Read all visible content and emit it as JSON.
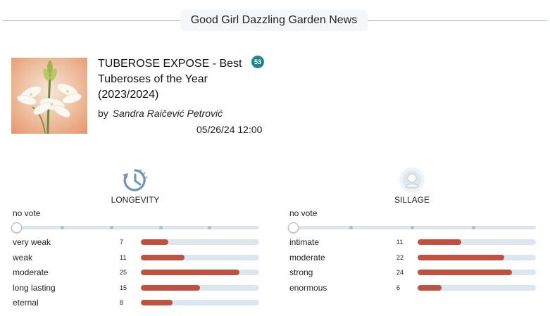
{
  "header": {
    "title": "Good Girl Dazzling Garden News"
  },
  "article": {
    "title": "TUBEROSE EXPOSE - Best Tuberoses of the Year (2023/2024)",
    "comment_count": "53",
    "byline_prefix": "by",
    "author": "Sandra Raičević Petrović",
    "date": "05/26/24 12:00",
    "thumb_icon": "tuberose-flower-image"
  },
  "longevity": {
    "label": "LONGEVITY",
    "icon": "clock-history-icon",
    "vote_label": "no vote",
    "max": 30,
    "rows": [
      {
        "label": "very weak",
        "count": 7
      },
      {
        "label": "weak",
        "count": 11
      },
      {
        "label": "moderate",
        "count": 25
      },
      {
        "label": "long lasting",
        "count": 15
      },
      {
        "label": "eternal",
        "count": 8
      }
    ]
  },
  "sillage": {
    "label": "SILLAGE",
    "icon": "person-aura-icon",
    "vote_label": "no vote",
    "max": 30,
    "rows": [
      {
        "label": "intimate",
        "count": 11
      },
      {
        "label": "moderate",
        "count": 22
      },
      {
        "label": "strong",
        "count": 24
      },
      {
        "label": "enormous",
        "count": 6
      }
    ]
  },
  "colors": {
    "bar_fill": "#c0503f",
    "bar_track": "#dbe6ef",
    "badge": "#1b8a8a"
  }
}
